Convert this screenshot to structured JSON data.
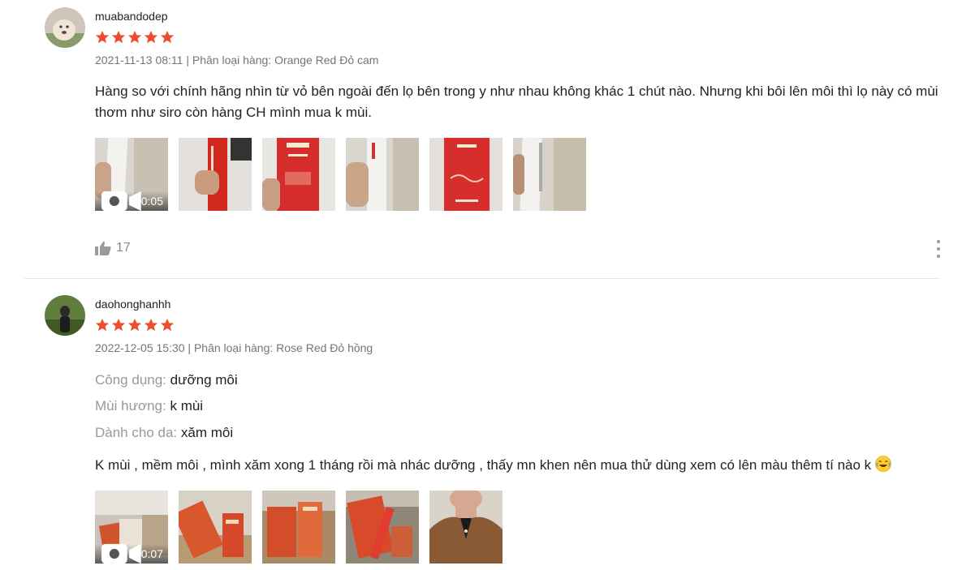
{
  "reviews": [
    {
      "username": "muabandodep",
      "rating": 5,
      "meta": "2021-11-13 08:11 | Phân loại hàng: Orange Red Đỏ cam",
      "content": "Hàng so với chính hãng nhìn từ vỏ bên ngoài đến lọ bên trong y như nhau không khác 1 chút nào. Nhưng khi bôi lên môi thì lọ này có mùi thơm như siro còn hàng CH mình mua k mùi.",
      "video_duration": "0:05",
      "like_count": "17"
    },
    {
      "username": "daohonghanhh",
      "rating": 5,
      "meta": "2022-12-05 15:30 | Phân loại hàng: Rose Red Đỏ hồng",
      "attributes": [
        {
          "label": "Công dụng:",
          "value": "dưỡng môi"
        },
        {
          "label": "Mùi hương:",
          "value": "k mùi"
        },
        {
          "label": "Dành cho da:",
          "value": "xăm môi"
        }
      ],
      "content": "K mùi , mềm môi , mình xăm xong 1 tháng rồi mà nhác dưỡng , thấy mn khen nên mua thử dùng xem có lên màu thêm tí nào k",
      "video_duration": "0:07"
    }
  ],
  "colors": {
    "star": "#ee4d2d",
    "meta": "#757575",
    "label": "#999999"
  },
  "icons": [
    "star-icon",
    "video-camera-icon",
    "thumbs-up-icon",
    "more-vertical-icon",
    "laughing-emoji-icon"
  ]
}
